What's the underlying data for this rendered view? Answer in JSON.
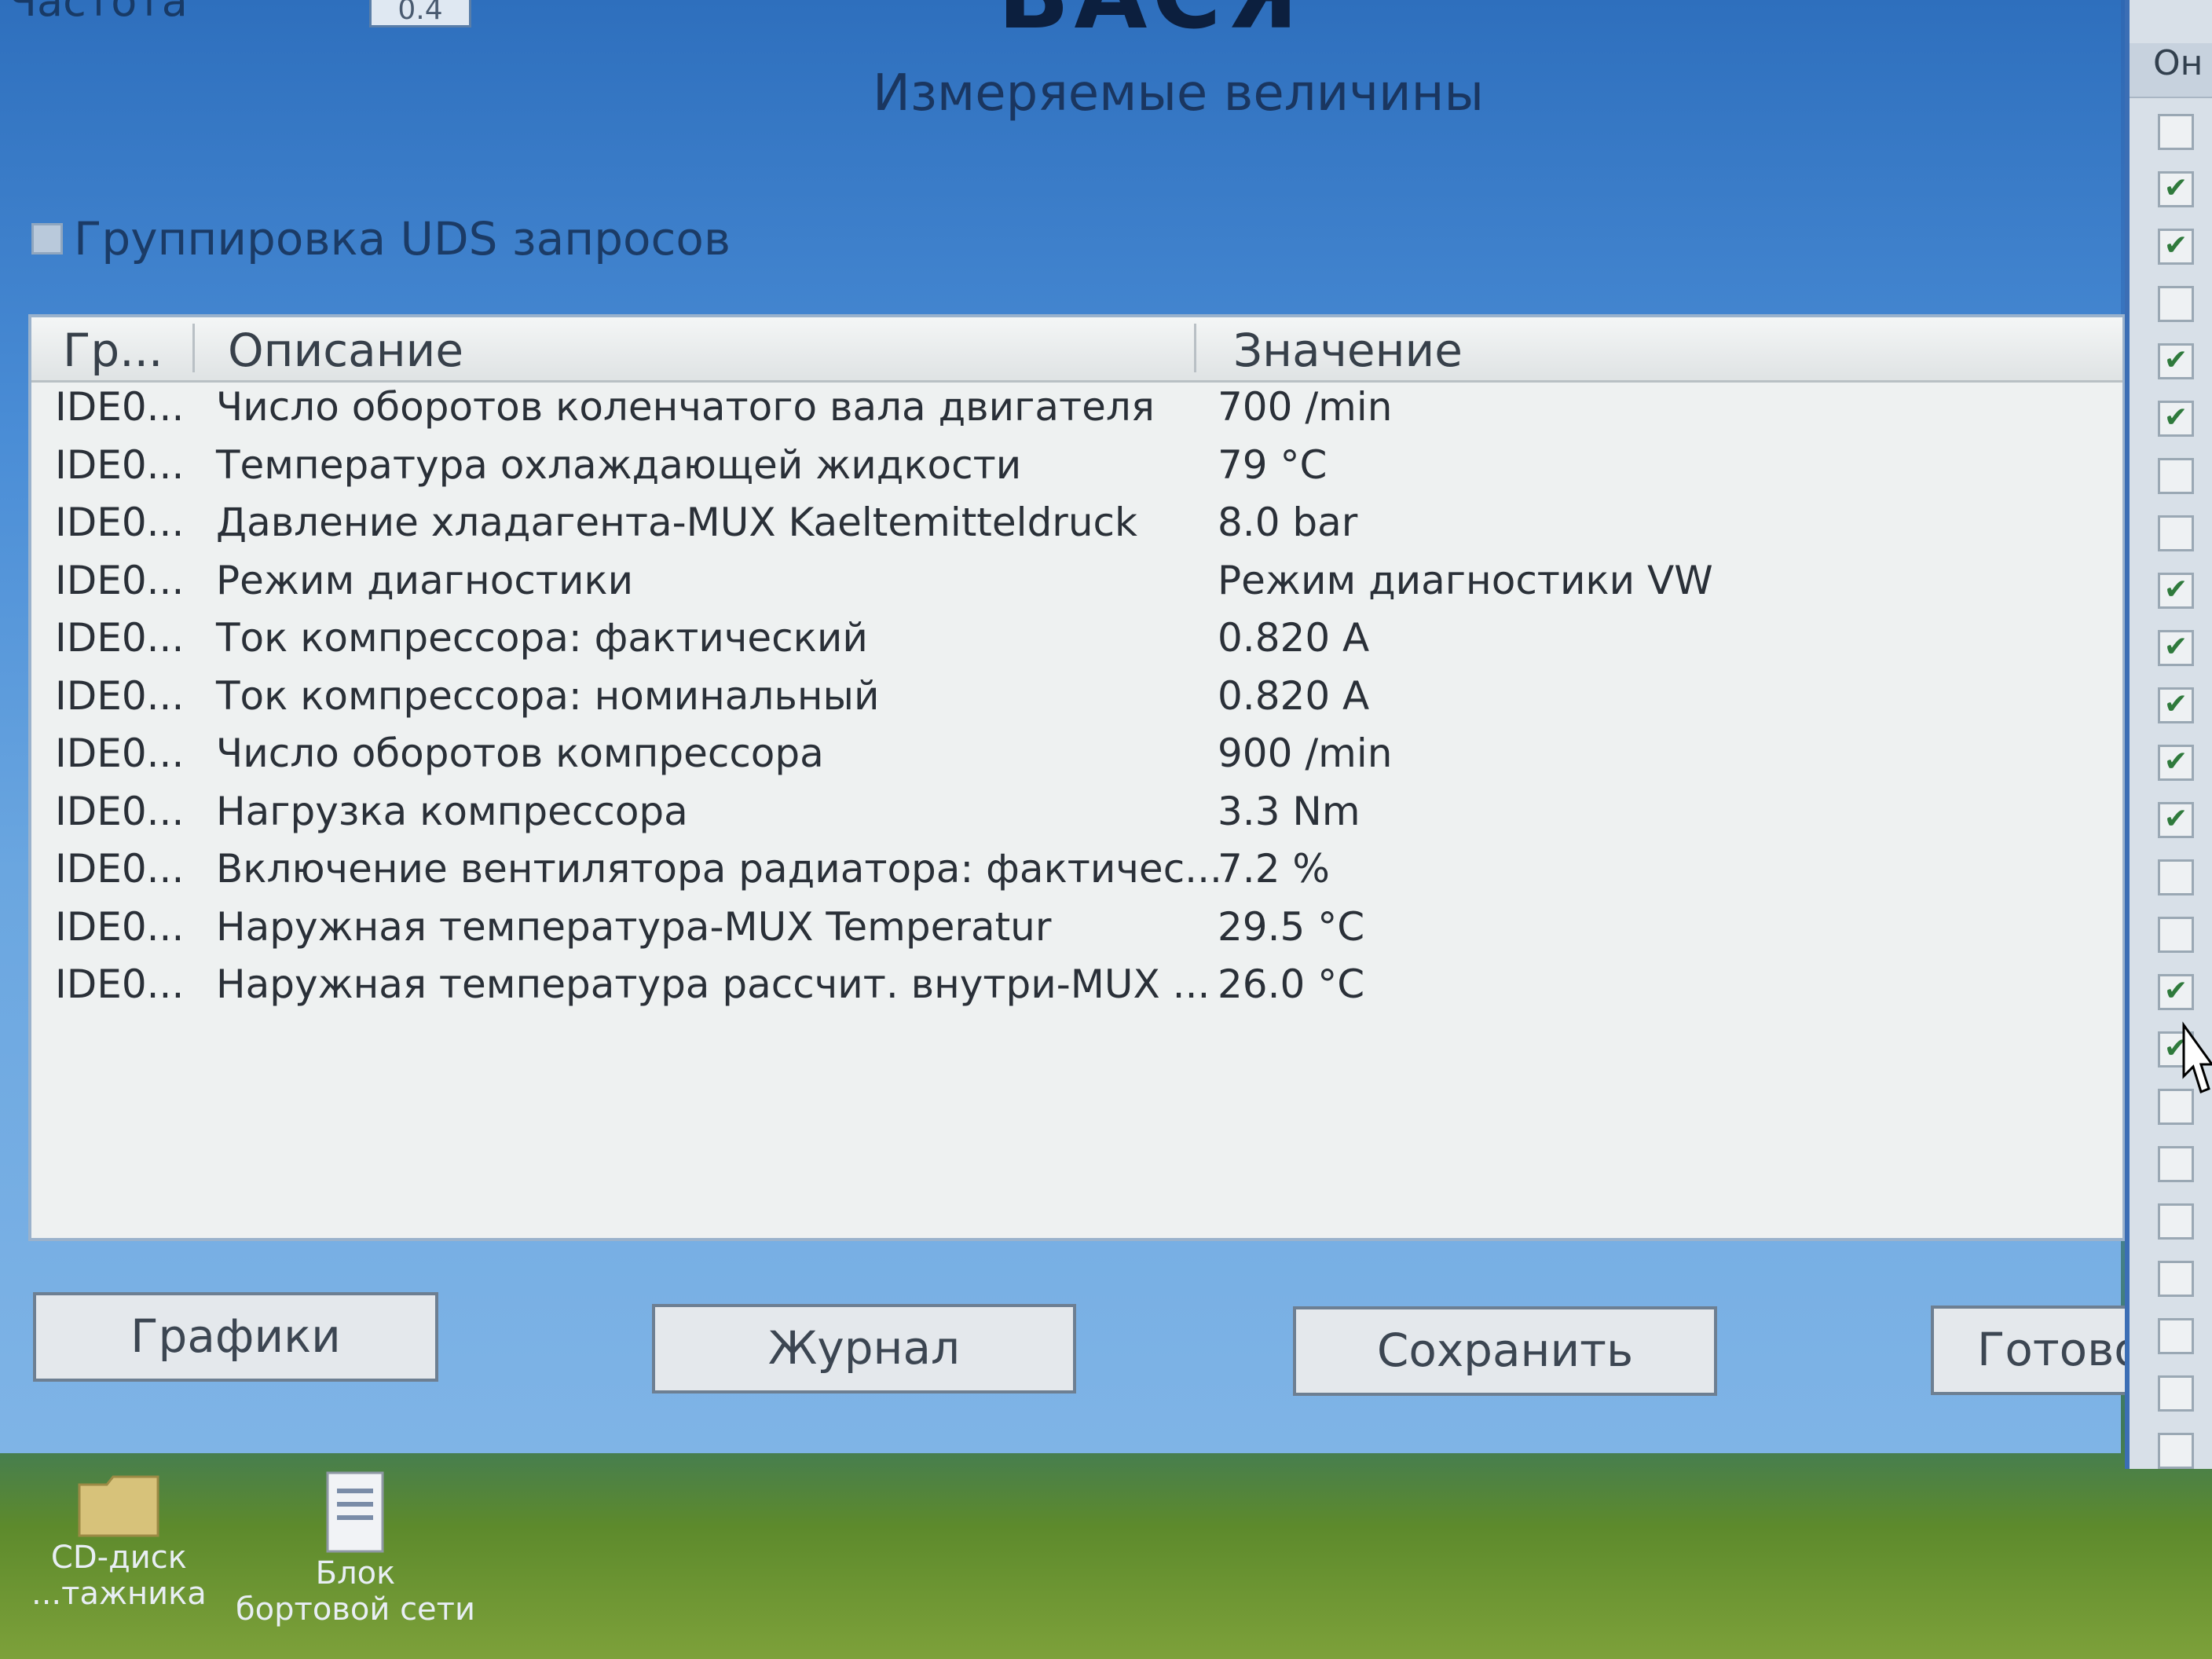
{
  "top_label": "Частота",
  "top_field_value": "0.4",
  "big_title": "ВАСЯ",
  "subtitle": "Измеряемые величины",
  "uds_grouping_label": "Группировка UDS запросов",
  "table": {
    "columns": [
      "Гр...",
      "Описание",
      "Значение"
    ],
    "rows": [
      {
        "group": "IDE0...",
        "description": "Число оборотов коленчатого вала двигателя",
        "value": "700 /min"
      },
      {
        "group": "IDE0...",
        "description": "Температура охлаждающей жидкости",
        "value": "79 °C"
      },
      {
        "group": "IDE0...",
        "description": "Давление хладагента-MUX Kaeltemitteldruck",
        "value": "8.0 bar"
      },
      {
        "group": "IDE0...",
        "description": "Режим диагностики",
        "value": "Режим диагностики VW"
      },
      {
        "group": "IDE0...",
        "description": "Ток компрессора: фактический",
        "value": "0.820 A"
      },
      {
        "group": "IDE0...",
        "description": "Ток компрессора: номинальный",
        "value": "0.820 A"
      },
      {
        "group": "IDE0...",
        "description": "Число оборотов компрессора",
        "value": "900 /min"
      },
      {
        "group": "IDE0...",
        "description": "Нагрузка компрессора",
        "value": "3.3 Nm"
      },
      {
        "group": "IDE0...",
        "description": "Включение вентилятора радиатора: фактичес...",
        "value": "7.2 %"
      },
      {
        "group": "IDE0...",
        "description": "Наружная температура-MUX Temperatur",
        "value": "29.5 °C"
      },
      {
        "group": "IDE0...",
        "description": "Наружная температура рассчит. внутри-MUX ...",
        "value": "26.0 °C"
      }
    ]
  },
  "buttons": {
    "graphs": "Графики",
    "journal": "Журнал",
    "save": "Сохранить",
    "done": "Готово"
  },
  "side_panel": {
    "header": "Он",
    "checkboxes": [
      false,
      true,
      true,
      false,
      true,
      true,
      false,
      false,
      true,
      true,
      true,
      true,
      true,
      false,
      false,
      true,
      true,
      false,
      false,
      false,
      false,
      false,
      false,
      false
    ]
  },
  "desktop_icons": [
    {
      "icon": "folder-icon",
      "label_line1": "CD-диск",
      "label_line2": "...тажника"
    },
    {
      "icon": "document-icon",
      "label_line1": "Блок",
      "label_line2": "бортовой сети"
    }
  ]
}
